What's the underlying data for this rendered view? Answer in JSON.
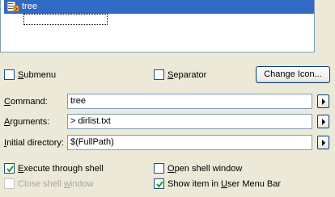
{
  "list": {
    "selected_item": "tree"
  },
  "options": {
    "submenu": {
      "label_pre": "",
      "label_key": "S",
      "label_post": "ubmenu",
      "checked": false
    },
    "separator": {
      "label_pre": "",
      "label_key": "S",
      "label_post": "eparator",
      "checked": false
    },
    "change_icon_label": "Change Icon..."
  },
  "fields": {
    "command": {
      "label_pre": "",
      "label_key": "C",
      "label_post": "ommand:",
      "value": "tree"
    },
    "arguments": {
      "label_pre": "",
      "label_key": "A",
      "label_post": "rguments:",
      "value": "> dirlist.txt"
    },
    "initial_directory": {
      "label_pre": "",
      "label_key": "I",
      "label_post": "nitial directory:",
      "value": "$(FullPath)"
    }
  },
  "flags": {
    "execute_through_shell": {
      "label_pre": "",
      "label_key": "E",
      "label_post": "xecute through shell",
      "checked": true,
      "enabled": true
    },
    "open_shell_window": {
      "label_pre": "",
      "label_key": "O",
      "label_post": "pen shell window",
      "checked": false,
      "enabled": true
    },
    "close_shell_window": {
      "label_pre": "Close shell ",
      "label_key": "w",
      "label_post": "indow",
      "checked": false,
      "enabled": false
    },
    "show_in_user_menu_bar": {
      "label_pre": "Show item in ",
      "label_key": "U",
      "label_post": "ser Menu Bar",
      "checked": true,
      "enabled": true
    }
  },
  "colors": {
    "selection": "#316ac5",
    "dialog_bg": "#ece9d8",
    "checkmark": "#21a121"
  },
  "icons": {
    "tree_item": "tree-command-icon",
    "arrow": "right-arrow-icon"
  }
}
